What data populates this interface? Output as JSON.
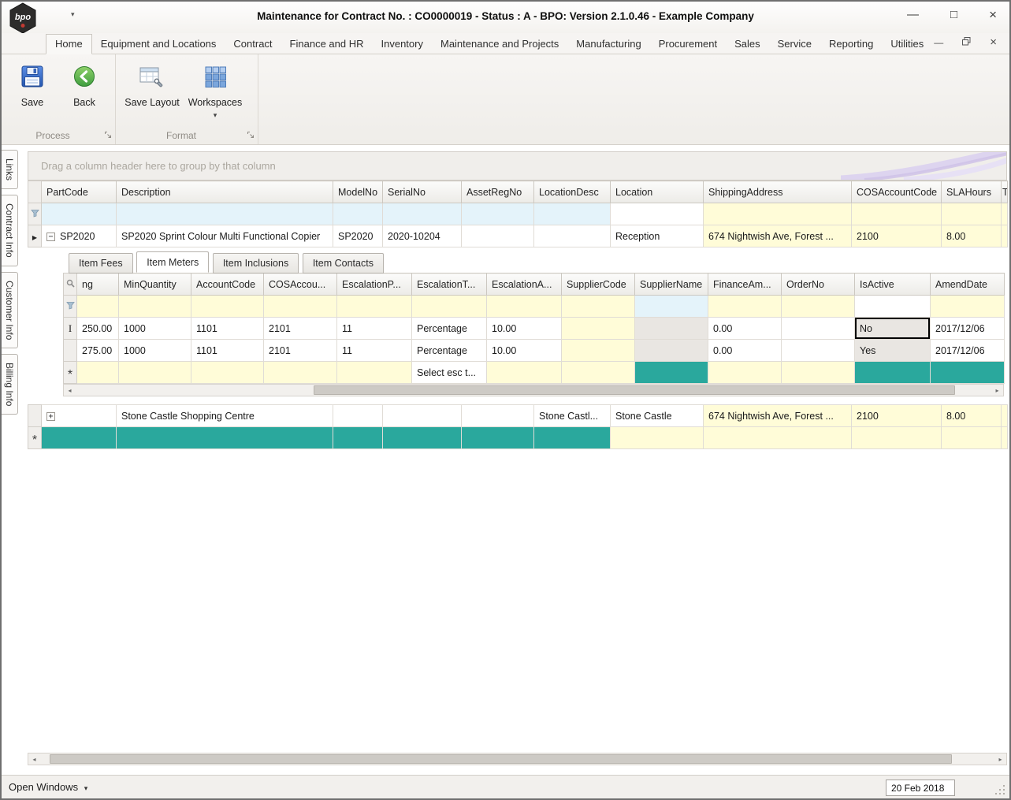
{
  "colors": {
    "teal_mandatory": "#2AA89D",
    "filter_blue": "#E4F3FA",
    "filter_yellow": "#FFFCD8",
    "disabled_gray": "#E9E6E2"
  },
  "titlebar": {
    "logo_text": "bpo",
    "title": "Maintenance for Contract No. : CO0000019 - Status : A - BPO: Version 2.1.0.46 - Example Company"
  },
  "menu": {
    "active_tab": "Home",
    "tabs": [
      "Home",
      "Equipment and Locations",
      "Contract",
      "Finance and HR",
      "Inventory",
      "Maintenance and Projects",
      "Manufacturing",
      "Procurement",
      "Sales",
      "Service",
      "Reporting",
      "Utilities"
    ]
  },
  "ribbon": {
    "save": "Save",
    "back": "Back",
    "save_layout": "Save Layout",
    "workspaces": "Workspaces",
    "group_process": "Process",
    "group_format": "Format"
  },
  "side_tabs": {
    "links": "Links",
    "contract_info": "Contract Info",
    "customer_info": "Customer Info",
    "billing_info": "Billing Info"
  },
  "master_grid": {
    "group_hint": "Drag a column header here to group by that column",
    "columns": [
      "PartCode",
      "Description",
      "ModelNo",
      "SerialNo",
      "AssetRegNo",
      "LocationDesc",
      "Location",
      "ShippingAddress",
      "COSAccountCode",
      "SLAHours",
      "T"
    ],
    "row1": {
      "part_code": "SP2020",
      "description": "SP2020 Sprint Colour Multi Functional Copier",
      "model_no": "SP2020",
      "serial_no": "2020-10204",
      "asset_reg_no": "",
      "location_desc": "",
      "location": "Reception",
      "shipping_address": "674 Nightwish Ave, Forest ...",
      "cos_account_code": "2100",
      "sla_hours": "8.00"
    },
    "row2": {
      "part_code": "",
      "description": "Stone Castle Shopping Centre",
      "model_no": "",
      "serial_no": "",
      "asset_reg_no": "",
      "location_desc": "Stone Castl...",
      "location": "Stone Castle",
      "shipping_address": "674 Nightwish Ave, Forest ...",
      "cos_account_code": "2100",
      "sla_hours": "8.00"
    }
  },
  "detail": {
    "active_tab": "Item Meters",
    "tabs": [
      "Item Fees",
      "Item Meters",
      "Item Inclusions",
      "Item Contacts"
    ],
    "columns": [
      "ng",
      "MinQuantity",
      "AccountCode",
      "COSAccou...",
      "EscalationP...",
      "EscalationT...",
      "EscalationA...",
      "SupplierCode",
      "SupplierName",
      "FinanceAm...",
      "OrderNo",
      "IsActive",
      "AmendDate"
    ],
    "rows": [
      {
        "reading": "250.00",
        "min_quantity": "1000",
        "account_code": "1101",
        "cos_account": "2101",
        "escalation_p": "11",
        "escalation_t": "Percentage",
        "escalation_a": "10.00",
        "supplier_code": "",
        "supplier_name": "",
        "finance_am": "0.00",
        "order_no": "",
        "is_active": "No",
        "amend_date": "2017/12/06"
      },
      {
        "reading": "275.00",
        "min_quantity": "1000",
        "account_code": "1101",
        "cos_account": "2101",
        "escalation_p": "11",
        "escalation_t": "Percentage",
        "escalation_a": "10.00",
        "supplier_code": "",
        "supplier_name": "",
        "finance_am": "0.00",
        "order_no": "",
        "is_active": "Yes",
        "amend_date": "2017/12/06"
      }
    ],
    "new_row_prompt": "Select esc t..."
  },
  "statusbar": {
    "open_windows": "Open Windows",
    "date": "20 Feb 2018"
  }
}
